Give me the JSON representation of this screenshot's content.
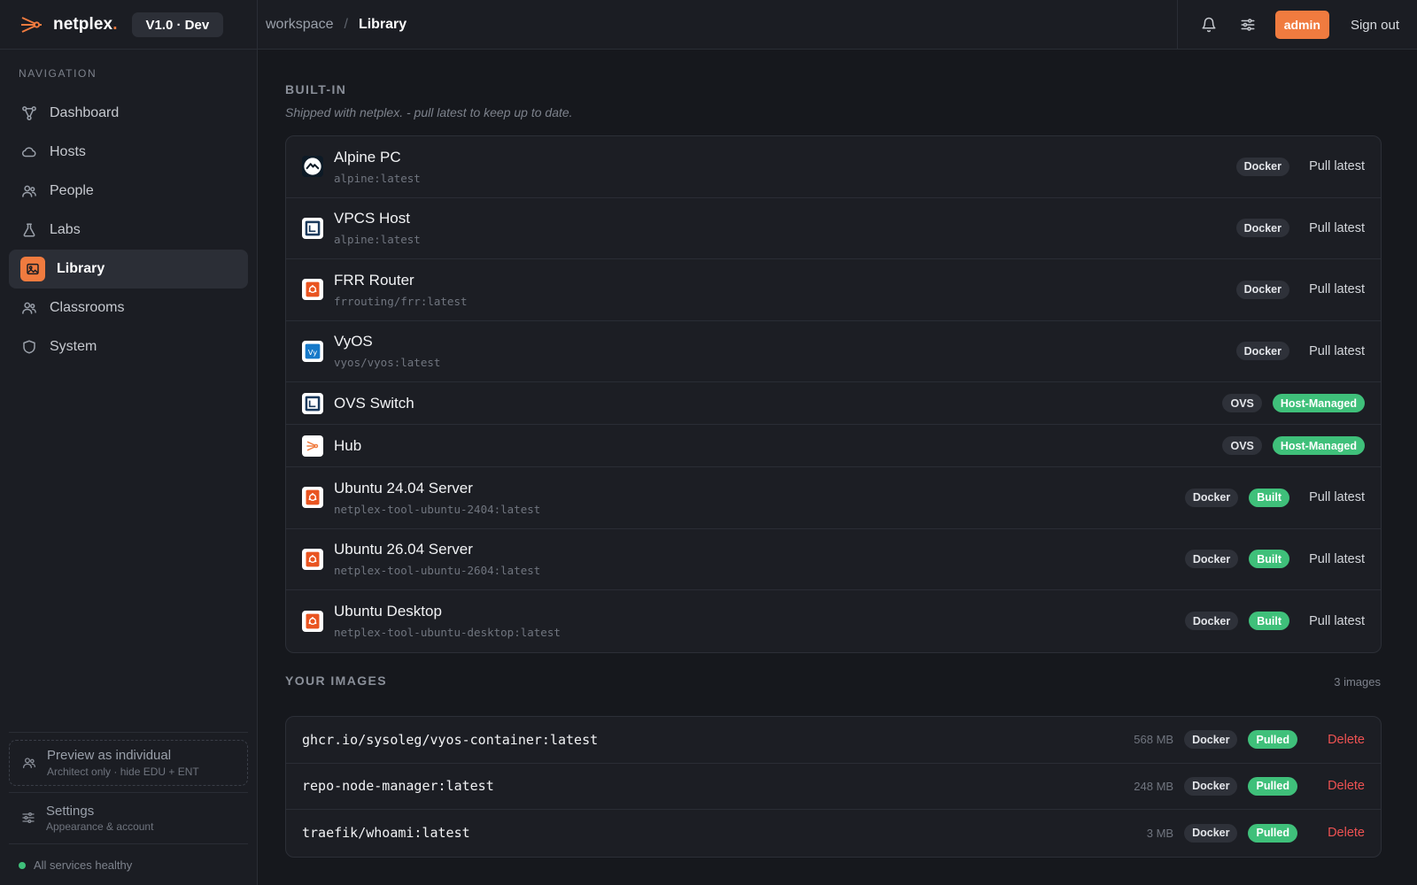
{
  "brand": {
    "name": "netplex",
    "dot": ".",
    "version": "V1.0 · Dev"
  },
  "breadcrumb": {
    "root": "workspace",
    "separator": "/",
    "current": "Library"
  },
  "topbar": {
    "role": "admin",
    "sign_out": "Sign out",
    "icons": [
      "bell-icon",
      "sliders-icon"
    ]
  },
  "sidebar": {
    "heading": "NAVIGATION",
    "items": [
      {
        "label": "Dashboard",
        "icon": "nodes-icon"
      },
      {
        "label": "Hosts",
        "icon": "cloud-icon"
      },
      {
        "label": "People",
        "icon": "people-icon"
      },
      {
        "label": "Labs",
        "icon": "flask-icon"
      },
      {
        "label": "Library",
        "icon": "image-icon",
        "active": true
      },
      {
        "label": "Classrooms",
        "icon": "people-icon"
      },
      {
        "label": "System",
        "icon": "shield-icon"
      }
    ],
    "preview": {
      "title": "Preview as individual",
      "subtitle": "Architect only · hide EDU + ENT"
    },
    "settings": {
      "title": "Settings",
      "subtitle": "Appearance & account"
    },
    "health": "All services healthy"
  },
  "builtin": {
    "title": "BUILT-IN",
    "subtitle": "Shipped with netplex. - pull latest to keep up to date.",
    "rows": [
      {
        "name": "Alpine PC",
        "image": "alpine:latest",
        "icon": "alpine-icon",
        "tags": [
          "Docker"
        ],
        "action": "Pull latest"
      },
      {
        "name": "VPCS Host",
        "image": "alpine:latest",
        "icon": "terminal-box-icon",
        "tags": [
          "Docker"
        ],
        "action": "Pull latest"
      },
      {
        "name": "FRR Router",
        "image": "frrouting/frr:latest",
        "icon": "ubuntu-icon",
        "tags": [
          "Docker"
        ],
        "action": "Pull latest"
      },
      {
        "name": "VyOS",
        "image": "vyos/vyos:latest",
        "icon": "vyos-icon",
        "tags": [
          "Docker"
        ],
        "action": "Pull latest"
      },
      {
        "name": "OVS Switch",
        "image": "",
        "icon": "terminal-box-icon",
        "tags": [
          "OVS"
        ],
        "managed": "Host-Managed"
      },
      {
        "name": "Hub",
        "image": "",
        "icon": "hub-icon",
        "tags": [
          "OVS"
        ],
        "managed": "Host-Managed"
      },
      {
        "name": "Ubuntu 24.04 Server",
        "image": "netplex-tool-ubuntu-2404:latest",
        "icon": "ubuntu-icon",
        "tags": [
          "Docker"
        ],
        "status": "Built",
        "action": "Pull latest"
      },
      {
        "name": "Ubuntu 26.04 Server",
        "image": "netplex-tool-ubuntu-2604:latest",
        "icon": "ubuntu-icon",
        "tags": [
          "Docker"
        ],
        "status": "Built",
        "action": "Pull latest"
      },
      {
        "name": "Ubuntu Desktop",
        "image": "netplex-tool-ubuntu-desktop:latest",
        "icon": "ubuntu-icon",
        "tags": [
          "Docker"
        ],
        "status": "Built",
        "action": "Pull latest"
      }
    ]
  },
  "your_images": {
    "title": "YOUR IMAGES",
    "count": "3 images",
    "rows": [
      {
        "name": "ghcr.io/sysoleg/vyos-container:latest",
        "size": "568 MB",
        "tag": "Docker",
        "status": "Pulled",
        "action": "Delete"
      },
      {
        "name": "repo-node-manager:latest",
        "size": "248 MB",
        "tag": "Docker",
        "status": "Pulled",
        "action": "Delete"
      },
      {
        "name": "traefik/whoami:latest",
        "size": "3 MB",
        "tag": "Docker",
        "status": "Pulled",
        "action": "Delete"
      }
    ]
  },
  "colors": {
    "accent": "#f07b3f",
    "success": "#3fc07a",
    "danger": "#ee5252",
    "background": "#16181d",
    "panel": "#1b1d23"
  }
}
